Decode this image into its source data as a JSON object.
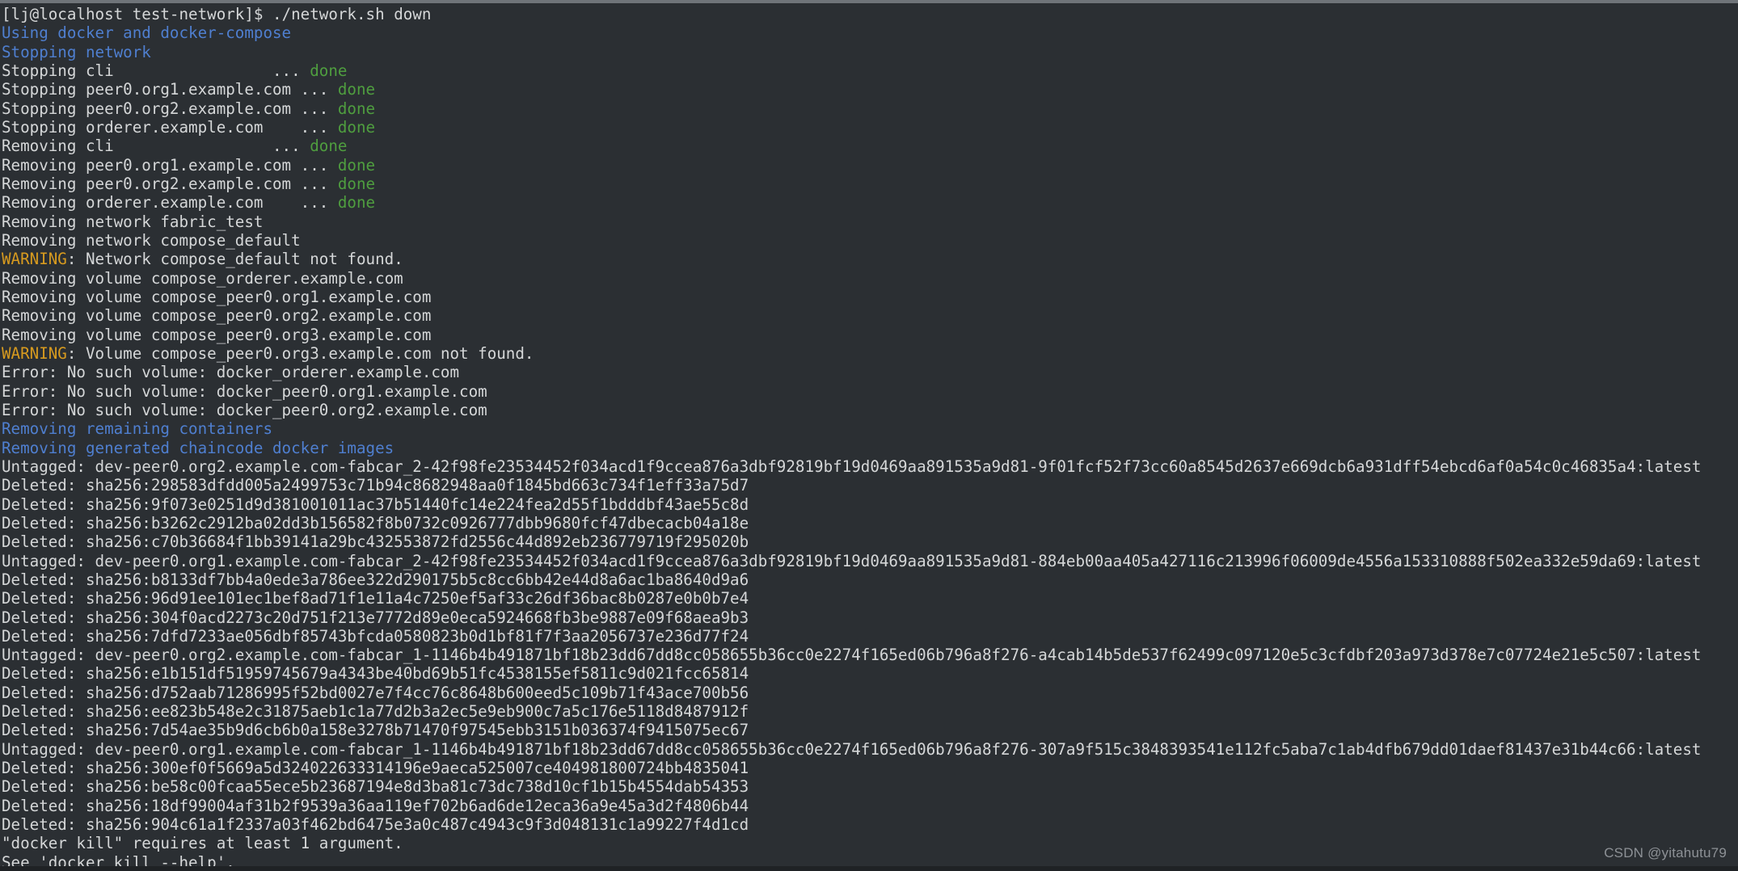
{
  "terminal": {
    "background": "#2b2f33",
    "foreground": "#d5d7d8",
    "blue": "#4f7fd0",
    "green": "#4f9e3f",
    "warning": "#d79a1f",
    "prompt": "[lj@localhost test-network]$ ",
    "command": "./network.sh down",
    "watermark": "CSDN @yitahutu79",
    "lines": [
      {
        "kind": "prompt",
        "prompt": "[lj@localhost test-network]$ ",
        "command": "./network.sh down"
      },
      {
        "kind": "blue",
        "text": "Using docker and docker-compose"
      },
      {
        "kind": "blue",
        "text": "Stopping network"
      },
      {
        "kind": "status",
        "label": "Stopping cli",
        "dots": "                 ... ",
        "status": "done"
      },
      {
        "kind": "status",
        "label": "Stopping peer0.org1.example.com",
        "dots": " ... ",
        "status": "done"
      },
      {
        "kind": "status",
        "label": "Stopping peer0.org2.example.com",
        "dots": " ... ",
        "status": "done"
      },
      {
        "kind": "status",
        "label": "Stopping orderer.example.com",
        "dots": "    ... ",
        "status": "done"
      },
      {
        "kind": "status",
        "label": "Removing cli",
        "dots": "                 ... ",
        "status": "done"
      },
      {
        "kind": "status",
        "label": "Removing peer0.org1.example.com",
        "dots": " ... ",
        "status": "done"
      },
      {
        "kind": "status",
        "label": "Removing peer0.org2.example.com",
        "dots": " ... ",
        "status": "done"
      },
      {
        "kind": "status",
        "label": "Removing orderer.example.com",
        "dots": "    ... ",
        "status": "done"
      },
      {
        "kind": "plain",
        "text": "Removing network fabric_test"
      },
      {
        "kind": "plain",
        "text": "Removing network compose_default"
      },
      {
        "kind": "warning",
        "tag": "WARNING",
        "text": ": Network compose_default not found."
      },
      {
        "kind": "plain",
        "text": "Removing volume compose_orderer.example.com"
      },
      {
        "kind": "plain",
        "text": "Removing volume compose_peer0.org1.example.com"
      },
      {
        "kind": "plain",
        "text": "Removing volume compose_peer0.org2.example.com"
      },
      {
        "kind": "plain",
        "text": "Removing volume compose_peer0.org3.example.com"
      },
      {
        "kind": "warning",
        "tag": "WARNING",
        "text": ": Volume compose_peer0.org3.example.com not found."
      },
      {
        "kind": "plain",
        "text": "Error: No such volume: docker_orderer.example.com"
      },
      {
        "kind": "plain",
        "text": "Error: No such volume: docker_peer0.org1.example.com"
      },
      {
        "kind": "plain",
        "text": "Error: No such volume: docker_peer0.org2.example.com"
      },
      {
        "kind": "blue",
        "text": "Removing remaining containers"
      },
      {
        "kind": "blue",
        "text": "Removing generated chaincode docker images"
      },
      {
        "kind": "plain",
        "text": "Untagged: dev-peer0.org2.example.com-fabcar_2-42f98fe23534452f034acd1f9ccea876a3dbf92819bf19d0469aa891535a9d81-9f01fcf52f73cc60a8545d2637e669dcb6a931dff54ebcd6af0a54c0c46835a4:latest"
      },
      {
        "kind": "plain",
        "text": "Deleted: sha256:298583dfdd005a2499753c71b94c8682948aa0f1845bd663c734f1eff33a75d7"
      },
      {
        "kind": "plain",
        "text": "Deleted: sha256:9f073e0251d9d381001011ac37b51440fc14e224fea2d55f1bdddbf43ae55c8d"
      },
      {
        "kind": "plain",
        "text": "Deleted: sha256:b3262c2912ba02dd3b156582f8b0732c0926777dbb9680fcf47dbecacb04a18e"
      },
      {
        "kind": "plain",
        "text": "Deleted: sha256:c70b36684f1bb39141a29bc432553872fd2556c44d892eb236779719f295020b"
      },
      {
        "kind": "plain",
        "text": "Untagged: dev-peer0.org1.example.com-fabcar_2-42f98fe23534452f034acd1f9ccea876a3dbf92819bf19d0469aa891535a9d81-884eb00aa405a427116c213996f06009de4556a153310888f502ea332e59da69:latest"
      },
      {
        "kind": "plain",
        "text": "Deleted: sha256:b8133df7bb4a0ede3a786ee322d290175b5c8cc6bb42e44d8a6ac1ba8640d9a6"
      },
      {
        "kind": "plain",
        "text": "Deleted: sha256:96d91ee101ec1bef8ad71f1e11a4c7250ef5af33c26df36bac8b0287e0b0b7e4"
      },
      {
        "kind": "plain",
        "text": "Deleted: sha256:304f0acd2273c20d751f213e7772d89e0eca5924668fb3be9887e09f68aea9b3"
      },
      {
        "kind": "plain",
        "text": "Deleted: sha256:7dfd7233ae056dbf85743bfcda0580823b0d1bf81f7f3aa2056737e236d77f24"
      },
      {
        "kind": "plain",
        "text": "Untagged: dev-peer0.org2.example.com-fabcar_1-1146b4b491871bf18b23dd67dd8cc058655b36cc0e2274f165ed06b796a8f276-a4cab14b5de537f62499c097120e5c3cfdbf203a973d378e7c07724e21e5c507:latest"
      },
      {
        "kind": "plain",
        "text": "Deleted: sha256:e1b151df51959745679a4343be40bd69b51fc4538155ef5811c9d021fcc65814"
      },
      {
        "kind": "plain",
        "text": "Deleted: sha256:d752aab71286995f52bd0027e7f4cc76c8648b600eed5c109b71f43ace700b56"
      },
      {
        "kind": "plain",
        "text": "Deleted: sha256:ee823b548e2c31875aeb1c1a77d2b3a2ec5e9eb900c7a5c176e5118d8487912f"
      },
      {
        "kind": "plain",
        "text": "Deleted: sha256:7d54ae35b9d6cb6b0a158e3278b71470f97545ebb3151b036374f9415075ec67"
      },
      {
        "kind": "plain",
        "text": "Untagged: dev-peer0.org1.example.com-fabcar_1-1146b4b491871bf18b23dd67dd8cc058655b36cc0e2274f165ed06b796a8f276-307a9f515c3848393541e112fc5aba7c1ab4dfb679dd01daef81437e31b44c66:latest"
      },
      {
        "kind": "plain",
        "text": "Deleted: sha256:300ef0f5669a5d324022633314196e9aeca525007ce404981800724bb4835041"
      },
      {
        "kind": "plain",
        "text": "Deleted: sha256:be58c00fcaa55ece5b23687194e8d3ba81c73dc738d10cf1b15b4554dab54353"
      },
      {
        "kind": "plain",
        "text": "Deleted: sha256:18df99004af31b2f9539a36aa119ef702b6ad6de12eca36a9e45a3d2f4806b44"
      },
      {
        "kind": "plain",
        "text": "Deleted: sha256:904c61a1f2337a03f462bd6475e3a0c487c4943c9f3d048131c1a99227f4d1cd"
      },
      {
        "kind": "plain",
        "text": "\"docker kill\" requires at least 1 argument."
      },
      {
        "kind": "plain",
        "text": "See 'docker kill --help'."
      }
    ]
  }
}
